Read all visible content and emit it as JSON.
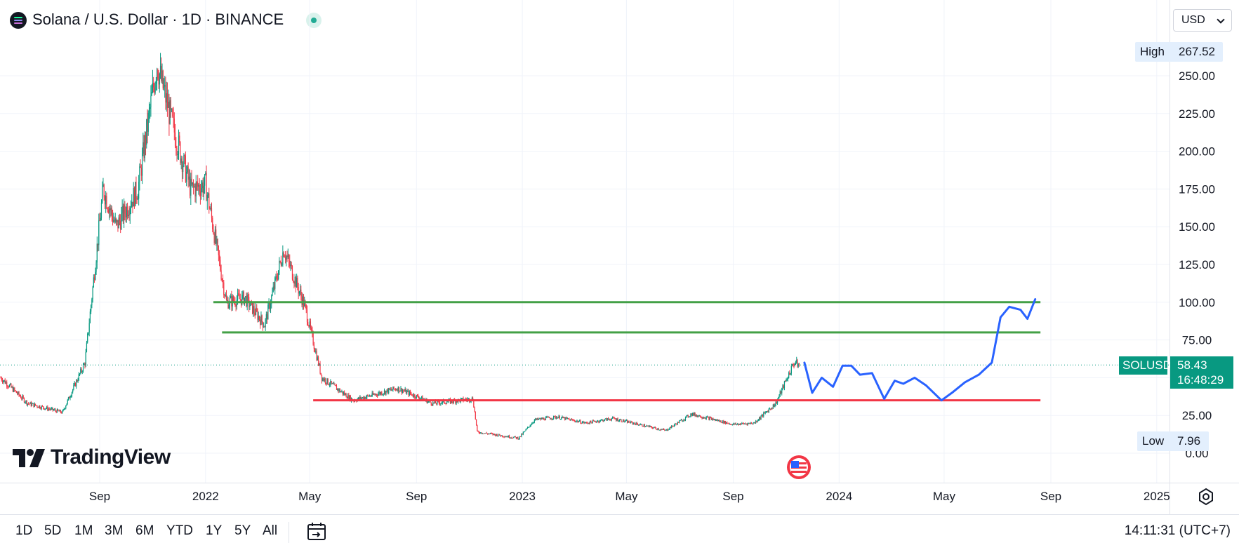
{
  "header": {
    "title": "Solana / U.S. Dollar · 1D · BINANCE",
    "currency": "USD"
  },
  "chart_data": {
    "type": "candlestick",
    "symbol": "SOLUSD",
    "ylim": [
      0,
      275
    ],
    "y_ticks": [
      0,
      25,
      50,
      75,
      100,
      125,
      150,
      175,
      200,
      225,
      250
    ],
    "y_tick_labels": [
      "0.00",
      "25.00",
      "50.00",
      "75.00",
      "100.00",
      "125.00",
      "150.00",
      "175.00",
      "200.00",
      "225.00",
      "250.00"
    ],
    "x_ticks": [
      {
        "label": "Sep",
        "date": "2021-09-01"
      },
      {
        "label": "2022",
        "date": "2022-01-01"
      },
      {
        "label": "May",
        "date": "2022-05-01"
      },
      {
        "label": "Sep",
        "date": "2022-09-01"
      },
      {
        "label": "2023",
        "date": "2023-01-01"
      },
      {
        "label": "May",
        "date": "2023-05-01"
      },
      {
        "label": "Sep",
        "date": "2023-09-01"
      },
      {
        "label": "2024",
        "date": "2024-01-01"
      },
      {
        "label": "May",
        "date": "2024-05-01"
      },
      {
        "label": "Sep",
        "date": "2024-09-01"
      },
      {
        "label": "2025",
        "date": "2025-01-01"
      }
    ],
    "price_path": [
      {
        "date": "2021-05-10",
        "price": 50
      },
      {
        "date": "2021-06-10",
        "price": 33
      },
      {
        "date": "2021-07-20",
        "price": 27
      },
      {
        "date": "2021-08-15",
        "price": 60
      },
      {
        "date": "2021-09-05",
        "price": 175
      },
      {
        "date": "2021-09-20",
        "price": 150
      },
      {
        "date": "2021-10-15",
        "price": 175
      },
      {
        "date": "2021-11-06",
        "price": 258
      },
      {
        "date": "2021-11-25",
        "price": 215
      },
      {
        "date": "2021-12-15",
        "price": 175
      },
      {
        "date": "2022-01-01",
        "price": 178
      },
      {
        "date": "2022-01-25",
        "price": 100
      },
      {
        "date": "2022-02-15",
        "price": 103
      },
      {
        "date": "2022-03-10",
        "price": 85
      },
      {
        "date": "2022-04-01",
        "price": 135
      },
      {
        "date": "2022-04-25",
        "price": 98
      },
      {
        "date": "2022-05-15",
        "price": 50
      },
      {
        "date": "2022-06-20",
        "price": 35
      },
      {
        "date": "2022-08-10",
        "price": 43
      },
      {
        "date": "2022-09-20",
        "price": 33
      },
      {
        "date": "2022-11-05",
        "price": 36
      },
      {
        "date": "2022-11-10",
        "price": 14
      },
      {
        "date": "2022-12-28",
        "price": 10
      },
      {
        "date": "2023-01-15",
        "price": 22
      },
      {
        "date": "2023-02-10",
        "price": 24
      },
      {
        "date": "2023-03-15",
        "price": 20
      },
      {
        "date": "2023-04-15",
        "price": 23
      },
      {
        "date": "2023-06-15",
        "price": 15
      },
      {
        "date": "2023-07-15",
        "price": 26
      },
      {
        "date": "2023-09-01",
        "price": 19
      },
      {
        "date": "2023-09-25",
        "price": 20
      },
      {
        "date": "2023-10-20",
        "price": 33
      },
      {
        "date": "2023-11-10",
        "price": 60
      },
      {
        "date": "2023-11-16",
        "price": 58.43
      }
    ],
    "horizontal_lines": [
      {
        "price": 100,
        "from": "2022-01-10",
        "to": "2024-08-20",
        "color": "#43a047"
      },
      {
        "price": 80,
        "from": "2022-01-20",
        "to": "2024-08-20",
        "color": "#43a047"
      },
      {
        "price": 35,
        "from": "2022-05-05",
        "to": "2024-08-20",
        "color": "#f23645"
      }
    ],
    "projection": {
      "color": "#2962ff",
      "points": [
        {
          "date": "2023-11-22",
          "price": 60
        },
        {
          "date": "2023-12-01",
          "price": 40
        },
        {
          "date": "2023-12-12",
          "price": 50
        },
        {
          "date": "2023-12-25",
          "price": 44
        },
        {
          "date": "2024-01-05",
          "price": 58
        },
        {
          "date": "2024-01-15",
          "price": 58
        },
        {
          "date": "2024-01-25",
          "price": 52
        },
        {
          "date": "2024-02-08",
          "price": 53
        },
        {
          "date": "2024-02-22",
          "price": 36
        },
        {
          "date": "2024-03-05",
          "price": 48
        },
        {
          "date": "2024-03-15",
          "price": 46
        },
        {
          "date": "2024-03-28",
          "price": 50
        },
        {
          "date": "2024-04-10",
          "price": 45
        },
        {
          "date": "2024-04-28",
          "price": 35
        },
        {
          "date": "2024-05-10",
          "price": 40
        },
        {
          "date": "2024-05-25",
          "price": 47
        },
        {
          "date": "2024-06-10",
          "price": 52
        },
        {
          "date": "2024-06-25",
          "price": 60
        },
        {
          "date": "2024-07-05",
          "price": 90
        },
        {
          "date": "2024-07-15",
          "price": 97
        },
        {
          "date": "2024-07-28",
          "price": 95
        },
        {
          "date": "2024-08-05",
          "price": 89
        },
        {
          "date": "2024-08-14",
          "price": 102
        }
      ]
    },
    "high": {
      "label": "High",
      "value": "267.52"
    },
    "low": {
      "label": "Low",
      "value": "7.96"
    },
    "last_price": {
      "symbol": "SOLUSD",
      "value": "58.43",
      "countdown": "16:48:29",
      "price": 58.43
    }
  },
  "footer": {
    "ranges": [
      "1D",
      "5D",
      "1M",
      "3M",
      "6M",
      "YTD",
      "1Y",
      "5Y",
      "All"
    ],
    "time": "14:11:31 (UTC+7)"
  },
  "brand": {
    "name": "TradingView"
  },
  "colors": {
    "up": "#089981",
    "down": "#f23645",
    "accent": "#2962ff"
  },
  "icons": {
    "symbol": "solana-logo-icon",
    "status": "market-status-icon",
    "goto": "goto-date-icon",
    "settings": "settings-icon",
    "event": "us-flag-event-icon"
  }
}
